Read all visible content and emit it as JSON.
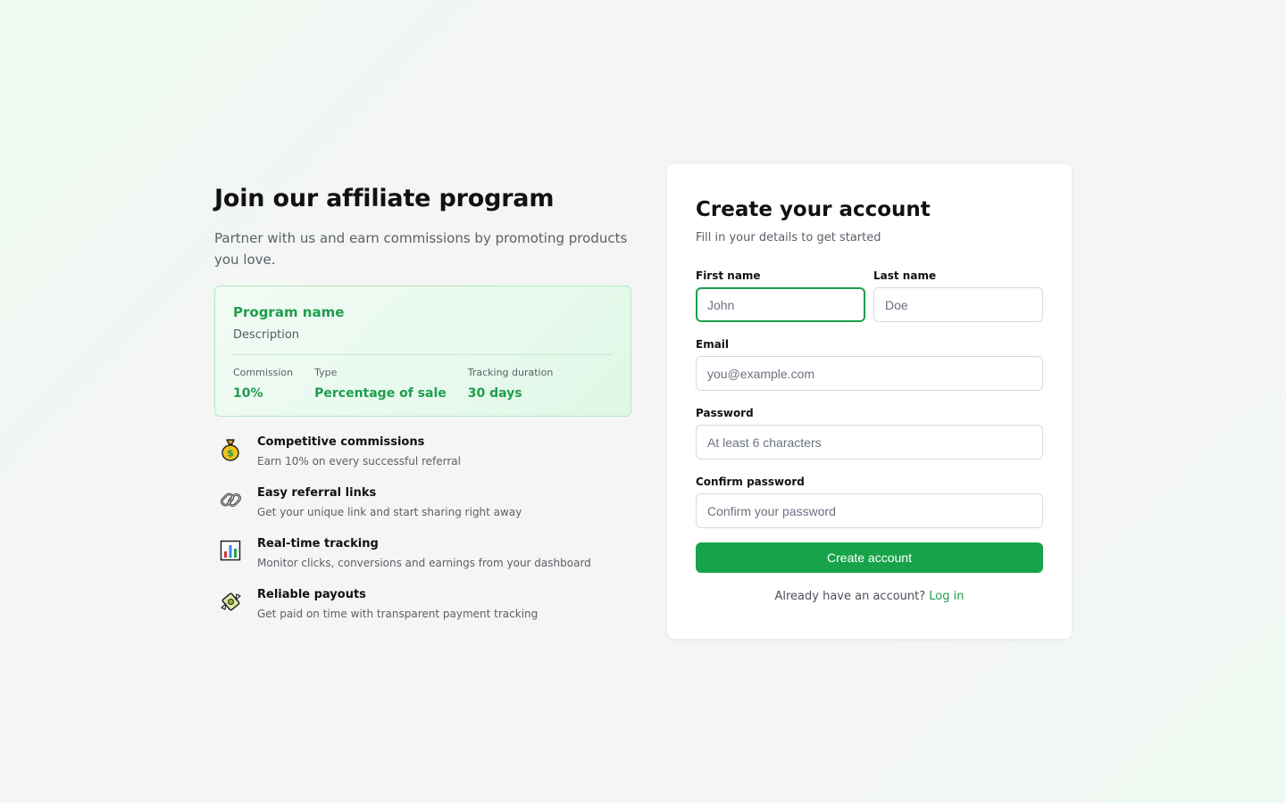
{
  "hero": {
    "title": "Join our affiliate program",
    "subtitle": "Partner with us and earn commissions by promoting products you love."
  },
  "program": {
    "name": "Program name",
    "description": "Description",
    "stats": [
      {
        "label": "Commission",
        "value": "10%"
      },
      {
        "label": "Type",
        "value": "Percentage of sale"
      },
      {
        "label": "Tracking duration",
        "value": "30 days"
      }
    ]
  },
  "features": [
    {
      "icon": "money-bag-icon",
      "title": "Competitive commissions",
      "description": "Earn 10% on every successful referral"
    },
    {
      "icon": "link-icon",
      "title": "Easy referral links",
      "description": "Get your unique link and start sharing right away"
    },
    {
      "icon": "bar-chart-icon",
      "title": "Real-time tracking",
      "description": "Monitor clicks, conversions and earnings from your dashboard"
    },
    {
      "icon": "money-wings-icon",
      "title": "Reliable payouts",
      "description": "Get paid on time with transparent payment tracking"
    }
  ],
  "form": {
    "title": "Create your account",
    "subtitle": "Fill in your details to get started",
    "first_name": {
      "label": "First name",
      "placeholder": "John",
      "value": ""
    },
    "last_name": {
      "label": "Last name",
      "placeholder": "Doe",
      "value": ""
    },
    "email": {
      "label": "Email",
      "placeholder": "you@example.com",
      "value": ""
    },
    "password": {
      "label": "Password",
      "placeholder": "At least 6 characters",
      "value": ""
    },
    "confirm_password": {
      "label": "Confirm password",
      "placeholder": "Confirm your password",
      "value": ""
    },
    "submit_label": "Create account",
    "login_prompt": "Already have an account?",
    "login_link": "Log in"
  },
  "colors": {
    "accent": "#17a34a",
    "accent_text": "#1f9d4d",
    "focus_border": "#1f9d4d"
  }
}
